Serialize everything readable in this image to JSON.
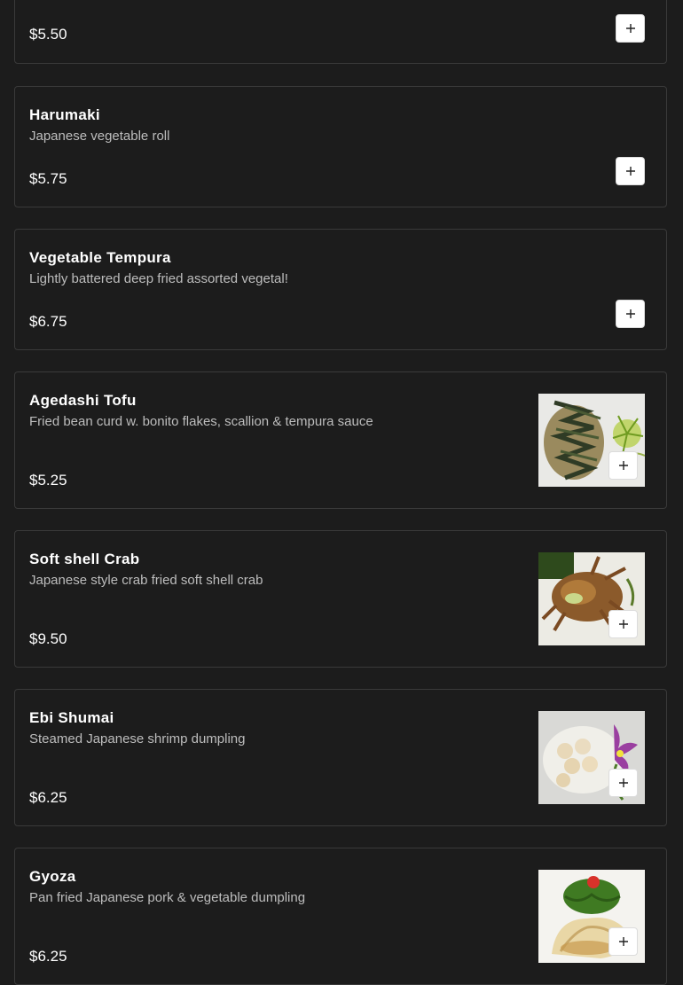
{
  "menu_items": [
    {
      "name": "",
      "description": "",
      "price": "$5.50",
      "add_label": "+"
    },
    {
      "name": "Harumaki",
      "description": "Japanese vegetable roll",
      "price": "$5.75",
      "add_label": "+"
    },
    {
      "name": "Vegetable Tempura",
      "description": "Lightly battered deep fried assorted vegetal!",
      "price": "$6.75",
      "add_label": "+"
    },
    {
      "name": "Agedashi Tofu",
      "description": "Fried bean curd w. bonito flakes, scallion & tempura sauce",
      "price": "$5.25",
      "add_label": "+",
      "image": "agedashi-tofu-photo"
    },
    {
      "name": "Soft shell Crab",
      "description": "Japanese style crab fried soft shell crab",
      "price": "$9.50",
      "add_label": "+",
      "image": "soft-shell-crab-photo"
    },
    {
      "name": "Ebi Shumai",
      "description": "Steamed Japanese shrimp dumpling",
      "price": "$6.25",
      "add_label": "+",
      "image": "ebi-shumai-photo"
    },
    {
      "name": "Gyoza",
      "description": "Pan fried Japanese pork & vegetable dumpling",
      "price": "$6.25",
      "add_label": "+",
      "image": "gyoza-photo"
    }
  ],
  "colors": {
    "background": "#1c1c1c",
    "card_border": "#3a3a3a",
    "title_text": "#ffffff",
    "description_text": "#bdbdbd",
    "button_bg": "#ffffff"
  }
}
